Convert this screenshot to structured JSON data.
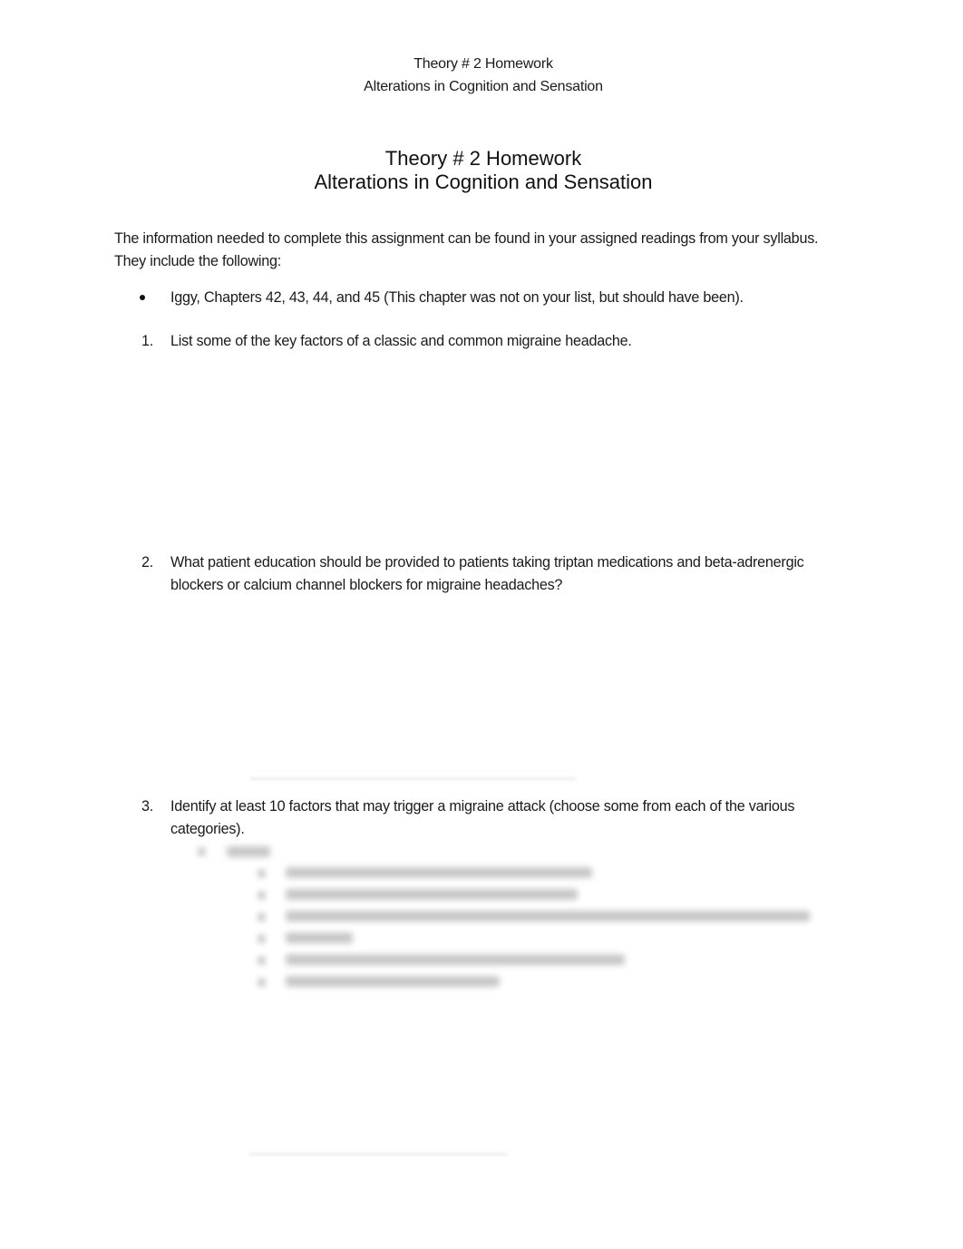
{
  "running_header": {
    "line1": "Theory # 2 Homework",
    "line2": "Alterations in Cognition and Sensation"
  },
  "title": {
    "line1": "Theory # 2 Homework",
    "line2": "Alterations in Cognition and Sensation"
  },
  "intro": "The information needed to complete this assignment can be found in your assigned readings from your syllabus. They include the following:",
  "readings": [
    {
      "marker": "•",
      "text": "Iggy, Chapters 42, 43, 44, and 45 (This chapter was not on your list, but should have been)."
    }
  ],
  "questions": [
    {
      "number": "1.",
      "text": "List some of the key factors of a classic and common migraine headache."
    },
    {
      "number": "2.",
      "text": "What patient education should be provided to patients taking triptan medications and beta-adrenergic blockers or calcium channel blockers for migraine headaches?"
    },
    {
      "number": "3.",
      "text": "Identify at least 10 factors that may trigger a migraine attack (choose some from each of the various categories)."
    }
  ],
  "obscured_content": {
    "note": "blurred",
    "sub_heading_count": 1,
    "sub_item_count": 6
  }
}
